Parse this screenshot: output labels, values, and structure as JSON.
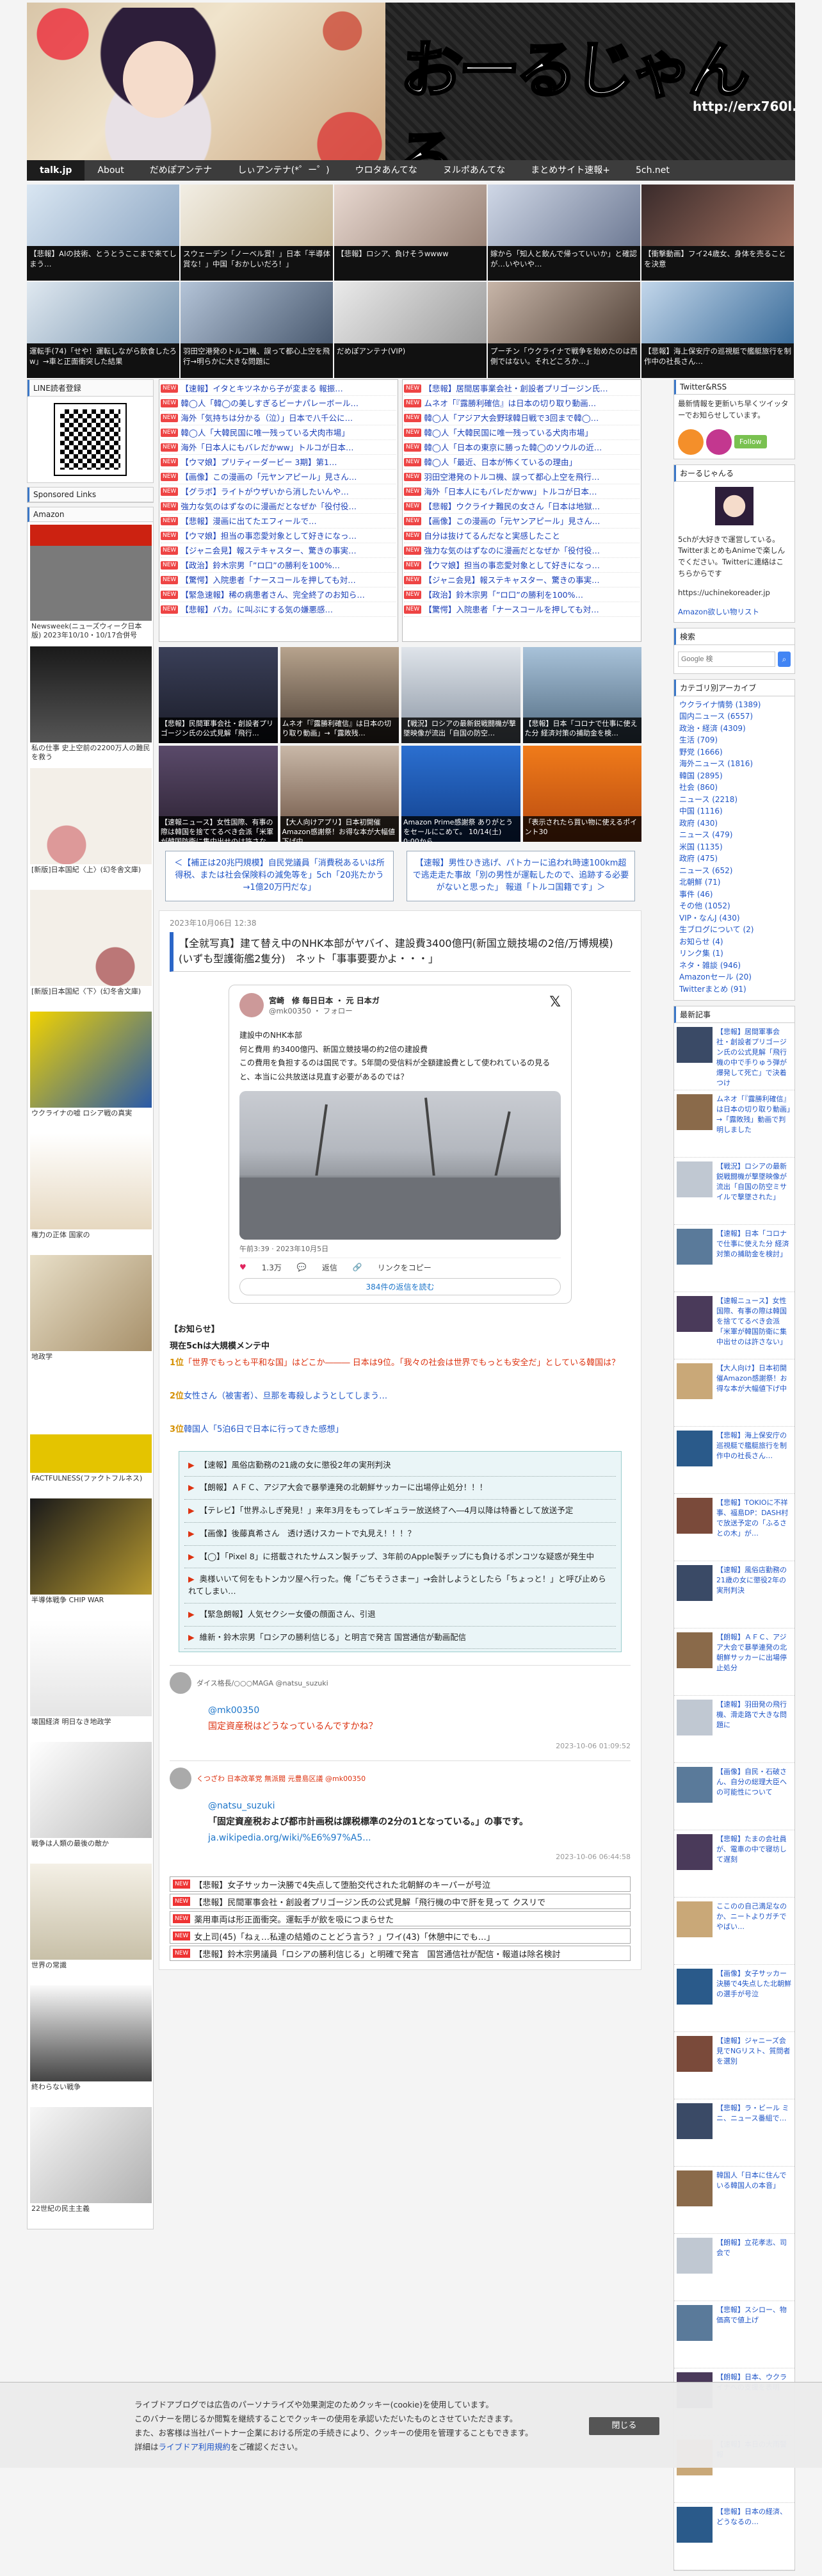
{
  "site": {
    "title": "おーるじゃんる",
    "url": "http://erx760l.com"
  },
  "nav": [
    "talk.jp",
    "About",
    "だめぽアンテナ",
    "しぃアンテナ(*゜ー゜)",
    "ウロタあんてな",
    "ヌルポあんてな",
    "まとめサイト速報+",
    "5ch.net"
  ],
  "thumbs": [
    "【悲報】AIの技術、とうとうここまで来てしまう…",
    "スウェーデン「ノーベル賞！」日本「半導体賞な！」中国「おかしいだろ！」",
    "【悲報】ロシア、負けそうwwww",
    "嫁から「知人と飲んで帰っていいか」と確認が…いやいや…",
    "【衝撃動画】フイ24歳女、身体を売ることを決意",
    "運転手(74)「せや！運転しながら飲食したろw」→車と正面衝突した結果",
    "羽田空港発のトルコ機、誤って都心上空を飛行→明らかに大きな問題に",
    "だめぽアンテナ(VIP)",
    "プーチン「ウクライナで戦争を始めたのは西側ではない。それどころか…」",
    "【悲報】海上保安庁の巡視艇で艦艇旅行を制作中の社長さん…"
  ],
  "left": {
    "line_title": "LINE読者登録",
    "sponsored_title": "Sponsored Links",
    "amazon_title": "Amazon",
    "books": [
      "Newsweek(ニューズウィーク日本版) 2023年10/10・10/17合併号",
      "私の仕事 史上空前の2200万人の難民を救う",
      "[新版]日本国紀〈上〉(幻冬舎文庫)",
      "[新版]日本国紀〈下〉(幻冬舎文庫)",
      "ウクライナの嘘 ロシア戦の真実",
      "権力の正体 国家の",
      "地政学",
      "FACTFULNESS(ファクトフルネス)",
      "半導体戦争 CHIP WAR",
      "壊国経済 明日なき地政学",
      "戦争は人類の最後の敵か",
      "世界の常識",
      "終わらない戦争",
      "22世紀の民主主義"
    ]
  },
  "rss_left": [
    "【速報】イタとキツネから子が変まる 報振…",
    "韓◯人「韓◯の美しすぎるビーナパレーボール…",
    "海外「気持ちは分かる（泣）」日本で八千公に…",
    "韓◯人「大韓民国に唯一残っている犬肉市場」",
    "海外「日本人にもバレだかww」トルコが日本…",
    "【ウマ娘】プリティーダービー 3期】第1…",
    "【画像】この漫画の「元ヤンアピール」見さん…",
    "【グラボ】ライトがウザいから消したいんや…",
    "強力な気のはずなのに漫画だとなぜか「役付役…",
    "【悲報】漫画に出てたエフィールで…",
    "【ウマ娘】担当の事恋愛対象として好きになっ…",
    "【ジャニ会見】報ステキャスター、驚きの事実…",
    "【政治】鈴木宗男「”ロ口”の勝利を100%…",
    "【驚愕】入院患者「ナースコールを押しても対…",
    "【緊急速報】稀の病患者さん、完全終了のお知ら…",
    "【悲報】バカ。に叫ぶにする気の嫌悪感…"
  ],
  "rss_right": [
    "【悲報】居間居事業会社・創設者プリゴージン氏…",
    "ムネオ「『露勝利確信』は日本の切り取り動画…",
    "韓◯人「アジア大会野球韓日戦で3回まで韓◯…",
    "韓◯人「大韓民国に唯一残っている犬肉市場」",
    "韓◯人「日本の東京に勝った韓◯のソウルの近…",
    "韓◯人「最近、日本が怖くているの理由」",
    "羽田空港発のトルコ機、誤って都心上空を飛行…",
    "海外「日本人にもバレだかww」トルコが日本…",
    "【悲報】ウクライナ難民の女さん「日本は地獄…",
    "【画像】この漫画の「元ヤンアピール」見さん…",
    "自分は抜けてるんだなと実感したこと",
    "強力な気のはずなのに漫画だとなぜか「役付役…",
    "【ウマ娘】担当の事恋愛対象として好きになっ…",
    "【ジャニ会見】報ステキャスター、驚きの事実…",
    "【政治】鈴木宗男「”ロ口”の勝利を100%…",
    "【驚愕】入院患者「ナースコールを押しても対…"
  ],
  "adcards": [
    "【悲報】民間軍事会社・創設者プリゴージン氏の公式見解「飛行…",
    "ムネオ「『露勝利確信』は日本の切り取り動画」→「露敗残…",
    "【戦況】ロシアの最新鋭戦闘機が撃墜映像が流出「自国の防空…",
    "【悲報】日本「コロナで仕事に使えた分 経済対策の捕助金を検…",
    "【速報ニュース】女性国際、有事の際は韓国を捨ててるべき会派「米軍が韓国防衛に集中出せのは許さない)",
    "【大人向けアプリ】日本初開催Amazon感謝祭！お得な本が大幅値下げ中",
    "Amazon Prime感謝祭 ありがとうをセールにこめて。 10/14(土) 0:00から",
    "「表示されたら買い物に使えるポイント30"
  ],
  "prevnext": [
    "＜【補正は20兆円規模】自民党議員「消費税あるいは所得税、または社会保険料の減免等を」5ch「20兆たかう→1億20万円だな」",
    "【速報】男性ひき逃げ、パトカーに追われ時速100km超で逃走走た事故「別の男性が運転したので、追跡する必要がないと思った」 報道「トルコ国籍です」＞"
  ],
  "article": {
    "date": "2023年10月06日 12:38",
    "title": "【全就写真】建て替え中のNHK本部がヤバイ、建設費3400億円(新国立競技場の2倍/万博規模)(いずも型護衛艦2隻分)　ネット「事事要要かよ・・・」",
    "tweet": {
      "name": "宮崎　修 毎日日本 ・ 元 日本ガ",
      "handle": "@mk00350 ・ フォロー",
      "line1": "建設中のNHK本部",
      "line2": "何と費用 約3400億円、新国立競技場の約2倍の建設費",
      "line3": "この費用を負担するのは国民です。5年間の受信料が全額建設費として使われているの見ると、本当に公共放送は見直す必要があるのでは？",
      "time": "午前3:39 · 2023年10月5日",
      "likes": "1.3万",
      "reply": "返信",
      "copy": "リンクをコピー",
      "more": "384件の返信を読む"
    },
    "notice": {
      "title": "【お知らせ】",
      "sub": "現在5chは大規模メンテ中",
      "l1_rank": "1位",
      "l1_text": "「世界でもっとも平和な国」はどこか――― 日本は9位。「我々の社会は世界でもっとも安全だ」としている韓国は？",
      "l2_rank": "2位",
      "l2_text": "女性さん（被害者）、旦那を毒殺しようとしてしまう…",
      "l3_rank": "3位",
      "l3_text": "韓国人「5泊6日で日本に行ってきた感想」"
    },
    "links": [
      "【速報】風俗店勤務の21歳の女に懲役2年の実刑判決",
      "【朗報】ＡＦＣ、アジア大会で暴挙連発の北朝鮮サッカーに出場停止処分！！！",
      "【テレビ】「世界ふしぎ発見！」来年3月をもってレギュラー放送終了へ―4月以降は特番として放送予定",
      "【画像】後藤真希さん　透け透けスカートで丸見え！！！？",
      "【◯】「Pixel 8」に搭載されたサムスン製チップ、3年前のApple製チップにも負けるポンコツな疑惑が発生中",
      "奥様いいて何をもトンカツ屋へ行った。俺「ごちそうさまー」→会計しようとしたら「ちょっと！」と呼び止められてしまい…",
      "【緊急朗報】人気セクシー女優の顔面さん、引退",
      "維新・鈴木宗男「ロシアの勝利信じる」と明言で発言 国営通信が動画配信"
    ],
    "comments": [
      {
        "name": "ダイス格長/○○○MAGA @natsu_suzuki",
        "mention": "@mk00350",
        "text": "国定資産税はどうなっているんですかね？",
        "time": "2023-10-06 01:09:52"
      },
      {
        "name": "くつざわ 日本改革党 無派閥 元豊島区議 @mk00350",
        "mention": "@natsu_suzuki",
        "text": "「固定資産税および都市計画税は課税標準の2分の1となっている。」の事です。",
        "link": "ja.wikipedia.org/wiki/%E6%97%A5...",
        "time": "2023-10-06 06:44:58"
      }
    ],
    "bottom": [
      "【悲報】女子サッカー決勝で4失点して堕胎交代された北朝鮮のキーパーが号泣",
      "【悲報】民間軍事会社・創設者プリゴージン氏の公式見解「飛行機の中で肝を見って クスリで",
      "薬用車両は形正面衝突。運転手が飲を吸につまらせた",
      "女上司(45)「ねぇ…私達の結婚のことどう言う？」ワイ(43)「休憩中にでも…」",
      "【悲報】鈴木宗男議員「ロシアの勝利信じる」と明確で発言　国営通信社が配信・報道は除名検討"
    ]
  },
  "right": {
    "twitter_title": "Twitter&RSS",
    "twitter_text": "最新情報を更新いち早くツイッターでお知らせしています。",
    "follow": "Follow",
    "about_title": "おーるじゃんる",
    "about_text": "5chが大好きで運営している。TwitterまとめもAnimeで楽しんでください。Twitterに連絡はこちらからです",
    "about_url": "https://uchinekoreader.jp",
    "about_amz": "Amazon欲しい物リスト",
    "search_title": "検索",
    "search_placeholder": "Google 検",
    "search_btn": "検索",
    "cat_title": "カテゴリ別アーカイブ",
    "cats": [
      "ウクライナ情勢 (1389)",
      "国内ニュース (6557)",
      "政治・経済 (4309)",
      "生活 (709)",
      "野党 (1666)",
      "海外ニュース (1816)",
      "韓国 (2895)",
      "社会 (860)",
      "ニュース (2218)",
      "中国 (1116)",
      "政府 (430)",
      "ニュース (479)",
      "米国 (1135)",
      "政府 (475)",
      "ニュース (652)",
      "北朝鮮 (71)",
      "事件 (46)",
      "その他 (1052)",
      "VIP・なんJ (430)",
      "生ブログについて (2)",
      "お知らせ (4)",
      "リンク集 (1)",
      "ネタ・雑談 (946)",
      "Amazonセール (20)",
      "Twitterまとめ (91)"
    ],
    "recent_title": "最新記事",
    "recent": [
      "【悲報】居間軍事会社・創設者プリゴージン氏の公式見解「飛行機の中で手りゅう弾が爆発して死亡」で決着つけ",
      "ムネオ「『露勝利確信』は日本の切り取り動画」→「露敗残」動画で判明しました",
      "【戦況】ロシアの最新鋭戦闘機が撃墜映像が流出「自国の防空ミサイルで撃墜された」",
      "【速報】日本「コロナで仕事に使えた分 経済対策の捕助金を検討」",
      "【速報ニュース】女性国際、有事の際は韓国を捨ててるべき会派「米軍が韓国防衛に集中出せのは許さない」",
      "【大人向け】日本初開催Amazon感謝祭！お得な本が大幅値下げ中",
      "【悲報】海上保安庁の巡視艇で艦艇旅行を制作中の社長さん…",
      "【悲報】TOKIOに不祥事、福島DP：DASH村で放送予定の「ふるさとの木」が…",
      "【速報】風俗店勤務の21歳の女に懲役2年の実刑判決",
      "【朗報】ＡＦＣ、アジア大会で暴挙連発の北朝鮮サッカーに出場停止処分",
      "【速報】羽田発の飛行機、滑走路で大きな問題に",
      "【画像】自民・石破さん、自分の総理大臣への可能性について",
      "【悲報】たまの会社員が、電車の中で寝坊して遅刻",
      "ここのの自己満足なのか、ニートよりガチでやばい…",
      "【画像】女子サッカー決勝で4失点した北朝鮮の選手が号泣",
      "【速報】ジャニーズ会見でNGリスト、質問者を選別",
      "【悲報】ラ・ビール ミニ、ニュース番組で…",
      "韓国人「日本に住んでいる韓国人の本音」",
      "【朗報】立花孝志、司会で",
      "【悲報】スシロー、物価高で値上げ",
      "【朗報】日本、ウクライナへの支援を表明",
      "【速報】本日の大雨警報",
      "【悲報】日本の経済、どうなるの…"
    ]
  },
  "cookie": {
    "line1": "ライブドアブログでは広告のパーソナライズや効果測定のためクッキー(cookie)を使用しています。",
    "line2": "このバナーを閉じるか閲覧を継続することでクッキーの使用を承認いただいたものとさせていただきます。",
    "line3": "また、お客様は当社パートナー企業における所定の手続きにより、クッキーの使用を管理することもできます。",
    "line4a": "詳細は",
    "link": "ライブドア利用規約",
    "line4b": "をご確認ください。",
    "close": "閉じる"
  }
}
